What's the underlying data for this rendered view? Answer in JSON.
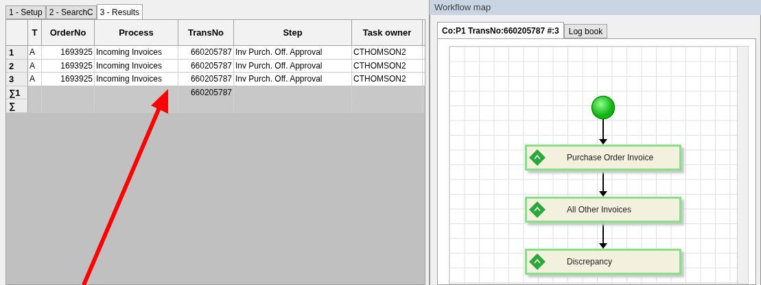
{
  "left_tabs": [
    {
      "label": "1 - Setup",
      "selected": false
    },
    {
      "label": "2 - SearchC",
      "selected": false
    },
    {
      "label": "3 - Results",
      "selected": true
    }
  ],
  "table": {
    "columns": [
      "T",
      "OrderNo",
      "Process",
      "TransNo",
      "Step",
      "Task owner"
    ],
    "rows": [
      {
        "header": "1",
        "cells": [
          "A",
          "1693925",
          "Incoming Invoices",
          "660205787",
          "Inv Purch. Off. Approval",
          "CTHOMSON2"
        ]
      },
      {
        "header": "2",
        "cells": [
          "A",
          "1693925",
          "Incoming Invoices",
          "660205787",
          "Inv Purch. Off. Approval",
          "CTHOMSON2"
        ]
      },
      {
        "header": "3",
        "cells": [
          "A",
          "1693925",
          "Incoming Invoices",
          "660205787",
          "Inv Purch. Off. Approval",
          "CTHOMSON2"
        ]
      }
    ],
    "summary_rows": [
      {
        "header": "∑1",
        "cells": [
          "",
          "",
          "",
          "660205787",
          "",
          ""
        ]
      },
      {
        "header": "∑",
        "cells": [
          "",
          "",
          "",
          "",
          "",
          ""
        ]
      }
    ]
  },
  "workflow": {
    "title": "Workflow map",
    "tabs": [
      {
        "label": "Co:P1 TransNo:660205787 #:3",
        "selected": true
      },
      {
        "label": "Log book",
        "selected": false
      }
    ],
    "nodes": [
      {
        "label": "Purchase Order Invoice"
      },
      {
        "label": "All Other Invoices"
      },
      {
        "label": "Discrepancy"
      }
    ]
  }
}
